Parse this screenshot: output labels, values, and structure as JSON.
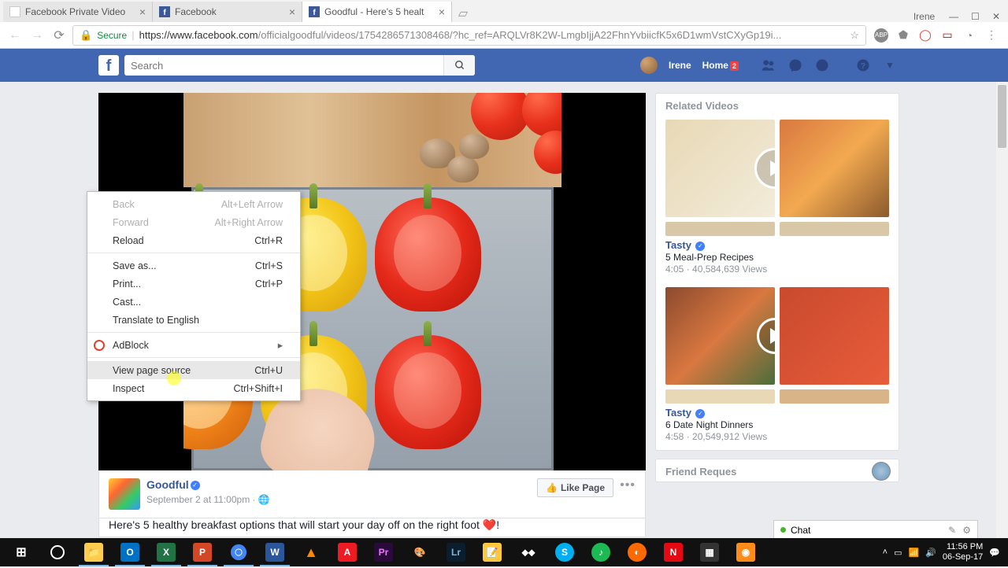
{
  "chrome": {
    "tabs": [
      {
        "title": "Facebook Private Video"
      },
      {
        "title": "Facebook"
      },
      {
        "title": "Goodful - Here's 5 healt"
      }
    ],
    "user": "Irene",
    "secure_label": "Secure",
    "url_host": "https://www.facebook.com",
    "url_path": "/officialgoodful/videos/1754286571308468/?hc_ref=ARQLVr8K2W-LmgbIjjA22FhnYvbiicfK5x6D1wmVstCXyGp19i..."
  },
  "fb": {
    "search_placeholder": "Search",
    "user": "Irene",
    "home": "Home",
    "home_badge": "2"
  },
  "context_menu": {
    "back": "Back",
    "back_k": "Alt+Left Arrow",
    "forward": "Forward",
    "forward_k": "Alt+Right Arrow",
    "reload": "Reload",
    "reload_k": "Ctrl+R",
    "saveas": "Save as...",
    "saveas_k": "Ctrl+S",
    "print": "Print...",
    "print_k": "Ctrl+P",
    "cast": "Cast...",
    "translate": "Translate to English",
    "adblock": "AdBlock",
    "vps": "View page source",
    "vps_k": "Ctrl+U",
    "inspect": "Inspect",
    "inspect_k": "Ctrl+Shift+I"
  },
  "post": {
    "page_name": "Goodful",
    "timestamp": "September 2 at 11:00pm",
    "like_label": "Like Page",
    "body": "Here's 5 healthy breakfast options that will start your day off on the right foot ❤️!"
  },
  "related": {
    "title": "Related Videos",
    "videos": [
      {
        "channel": "Tasty",
        "title": "5 Meal-Prep Recipes",
        "dur": "4:05",
        "views": "40,584,639 Views"
      },
      {
        "channel": "Tasty",
        "title": "6 Date Night Dinners",
        "dur": "4:58",
        "views": "20,549,912 Views"
      }
    ],
    "friend_req": "Friend Reques"
  },
  "chat": {
    "label": "Chat"
  },
  "tray": {
    "time": "11:56 PM",
    "date": "06-Sep-17"
  }
}
